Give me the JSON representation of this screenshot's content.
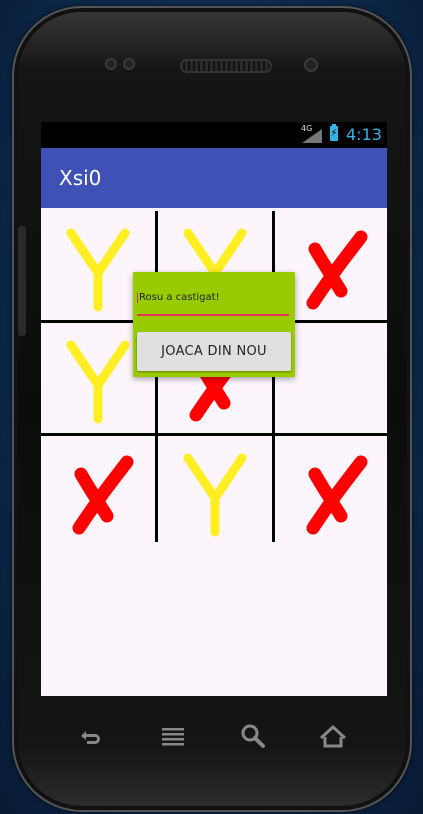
{
  "status_bar": {
    "network": "4G",
    "time": "4:13"
  },
  "app_bar": {
    "title": "Xsi0"
  },
  "board": {
    "cells": [
      "Y",
      "Y",
      "X",
      "Y",
      "X",
      "",
      "X",
      "Y",
      "X"
    ]
  },
  "dialog": {
    "message": "Rosu a castigat!",
    "button_label": "JOACA DIN NOU"
  },
  "nav_icons": [
    "back-icon",
    "menu-icon",
    "search-icon",
    "home-icon"
  ],
  "colors": {
    "app_bar": "#3f51b5",
    "dialog": "#99cc00",
    "x_mark": "#ff0000",
    "y_mark": "#ffee22"
  }
}
